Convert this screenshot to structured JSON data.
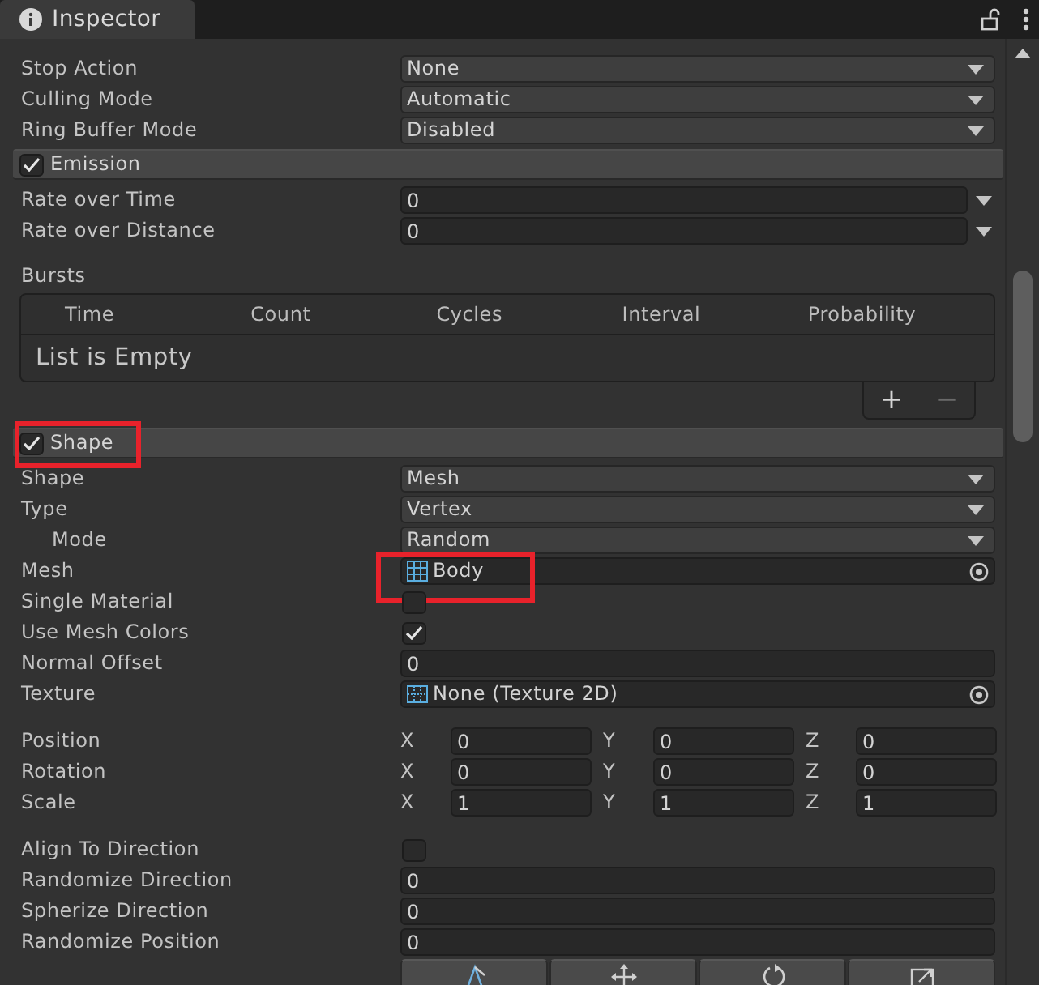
{
  "window": {
    "title": "Inspector"
  },
  "sections": [
    {
      "groups": [
        [
          {
            "kind": "dropdown",
            "label": "Stop Action",
            "value": "None",
            "highlighted": false
          },
          {
            "kind": "dropdown",
            "label": "Culling Mode",
            "value": "Automatic",
            "highlighted": false
          },
          {
            "kind": "dropdown",
            "label": "Ring Buffer Mode",
            "value": "Disabled",
            "highlighted": false
          }
        ]
      ]
    },
    {
      "header": {
        "label": "Emission",
        "checked": true,
        "highlighted": false
      },
      "groups": [
        [
          {
            "kind": "curve",
            "label": "Rate over Time",
            "value": "0",
            "highlighted": false
          },
          {
            "kind": "curve",
            "label": "Rate over Distance",
            "value": "0",
            "highlighted": false
          }
        ],
        [
          {
            "kind": "list",
            "label": "Bursts",
            "columns": [
              "Time",
              "Count",
              "Cycles",
              "Interval",
              "Probability"
            ],
            "empty_text": "List is Empty",
            "buttons": [
              {
                "label": "+",
                "disabled": false
              },
              {
                "label": "−",
                "disabled": true
              }
            ],
            "highlighted": false
          }
        ]
      ]
    },
    {
      "header": {
        "label": "Shape",
        "checked": true,
        "highlighted": true
      },
      "groups": [
        [
          {
            "kind": "dropdown",
            "label": "Shape",
            "value": "Mesh",
            "highlighted": false
          },
          {
            "kind": "dropdown",
            "label": "Type",
            "value": "Vertex",
            "highlighted": false,
            "children": [
              {
                "kind": "dropdown",
                "label": "Mode",
                "value": "Random",
                "highlighted": false
              }
            ]
          },
          {
            "kind": "mesh",
            "label": "Mesh",
            "value": "Body",
            "highlighted": true
          },
          {
            "kind": "checkbox",
            "label": "Single Material",
            "checked": false,
            "highlighted": false
          },
          {
            "kind": "checkbox",
            "label": "Use Mesh Colors",
            "checked": true,
            "highlighted": false
          },
          {
            "kind": "number",
            "label": "Normal Offset",
            "value": "0",
            "highlighted": false
          },
          {
            "kind": "texture",
            "label": "Texture",
            "value": "None (Texture 2D)",
            "highlighted": false
          }
        ],
        [
          {
            "kind": "vector",
            "label": "Position",
            "components": [
              {
                "axis": "X",
                "value": "0"
              },
              {
                "axis": "Y",
                "value": "0"
              },
              {
                "axis": "Z",
                "value": "0"
              }
            ],
            "highlighted": false
          },
          {
            "kind": "vector",
            "label": "Rotation",
            "components": [
              {
                "axis": "X",
                "value": "0"
              },
              {
                "axis": "Y",
                "value": "0"
              },
              {
                "axis": "Z",
                "value": "0"
              }
            ],
            "highlighted": false
          },
          {
            "kind": "vector",
            "label": "Scale",
            "components": [
              {
                "axis": "X",
                "value": "1"
              },
              {
                "axis": "Y",
                "value": "1"
              },
              {
                "axis": "Z",
                "value": "1"
              }
            ],
            "highlighted": false
          }
        ],
        [
          {
            "kind": "checkbox",
            "label": "Align To Direction",
            "checked": false,
            "highlighted": false
          },
          {
            "kind": "number",
            "label": "Randomize Direction",
            "value": "0",
            "highlighted": false
          },
          {
            "kind": "number",
            "label": "Spherize Direction",
            "value": "0",
            "highlighted": false
          },
          {
            "kind": "number",
            "label": "Randomize Position",
            "value": "0",
            "highlighted": false
          },
          {
            "kind": "tools",
            "highlighted": false
          }
        ]
      ]
    }
  ]
}
